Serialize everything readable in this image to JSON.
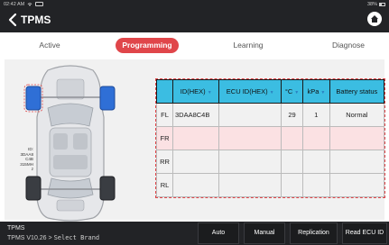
{
  "status": {
    "time": "02:42 AM",
    "battery": "38%"
  },
  "header": {
    "title": "TPMS"
  },
  "tabs": [
    {
      "label": "Active"
    },
    {
      "label": "Programming",
      "active": true
    },
    {
      "label": "Learning"
    },
    {
      "label": "Diagnose"
    }
  ],
  "sensor_label": [
    "ID:",
    "3DAA8",
    "C4B",
    "315MH",
    "z"
  ],
  "table": {
    "headers": [
      "ID(HEX)",
      "ECU ID(HEX)",
      "°C",
      "kPa",
      "Battery status"
    ],
    "rows": [
      {
        "pos": "FL",
        "id": "3DAA8C4B",
        "ecu": "",
        "temp": "29",
        "kpa": "1",
        "battery": "Normal"
      },
      {
        "pos": "FR",
        "id": "",
        "ecu": "",
        "temp": "",
        "kpa": "",
        "battery": ""
      },
      {
        "pos": "RR",
        "id": "",
        "ecu": "",
        "temp": "",
        "kpa": "",
        "battery": ""
      },
      {
        "pos": "RL",
        "id": "",
        "ecu": "",
        "temp": "",
        "kpa": "",
        "battery": ""
      }
    ]
  },
  "footer": {
    "title": "TPMS",
    "version": "TPMS V10.26 >",
    "path": "Select Brand"
  },
  "buttons": {
    "auto": "Auto",
    "manual": "Manual",
    "replication": "Replication",
    "read_ecu_id": "Read ECU ID"
  },
  "colors": {
    "accent": "#e0464a",
    "table_header": "#3bbde2",
    "selected_row": "#fbe1e3",
    "wheel_sensor": "#2f6fd6"
  }
}
